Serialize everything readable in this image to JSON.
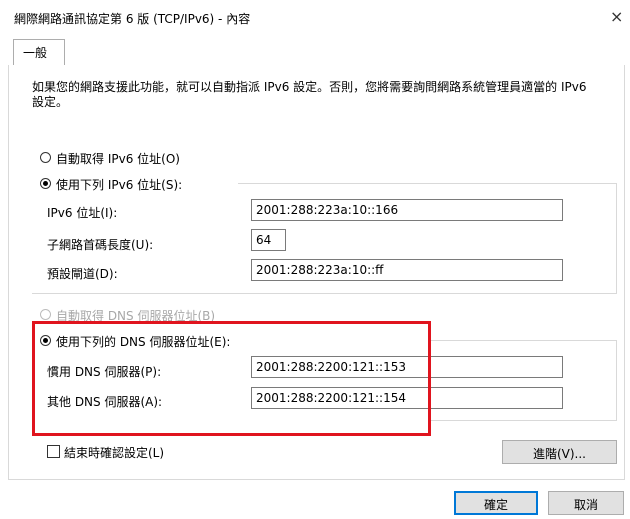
{
  "window": {
    "title": "網際網路通訊協定第 6 版 (TCP/IPv6) - 內容",
    "close_glyph": "×"
  },
  "tabs": [
    {
      "label": "一般"
    }
  ],
  "general": {
    "description": "如果您的網路支援此功能，就可以自動指派 IPv6 設定。否則，您將需要詢問網路系統管理員適當的 IPv6 設定。",
    "ip_auto_label": "自動取得 IPv6 位址(O)",
    "ip_manual_label": "使用下列 IPv6 位址(S):",
    "ip_mode": "manual",
    "ipv6_address_label": "IPv6 位址(I):",
    "ipv6_address_value": "2001:288:223a:10::166",
    "prefix_length_label": "子網路首碼長度(U):",
    "prefix_length_value": "64",
    "gateway_label": "預設閘道(D):",
    "gateway_value": "2001:288:223a:10::ff",
    "dns_auto_label": "自動取得 DNS 伺服器位址(B)",
    "dns_manual_label": "使用下列的 DNS 伺服器位址(E):",
    "dns_mode": "manual",
    "preferred_dns_label": "慣用 DNS 伺服器(P):",
    "preferred_dns_value": "2001:288:2200:121::153",
    "alternate_dns_label": "其他 DNS 伺服器(A):",
    "alternate_dns_value": "2001:288:2200:121::154",
    "validate_on_exit_label": "結束時確認設定(L)",
    "validate_on_exit_checked": false,
    "advanced_button": "進階(V)..."
  },
  "footer": {
    "ok_button": "確定",
    "cancel_button": "取消"
  },
  "colors": {
    "highlight_box": "#e0141e",
    "primary_button_border": "#0078d7"
  }
}
